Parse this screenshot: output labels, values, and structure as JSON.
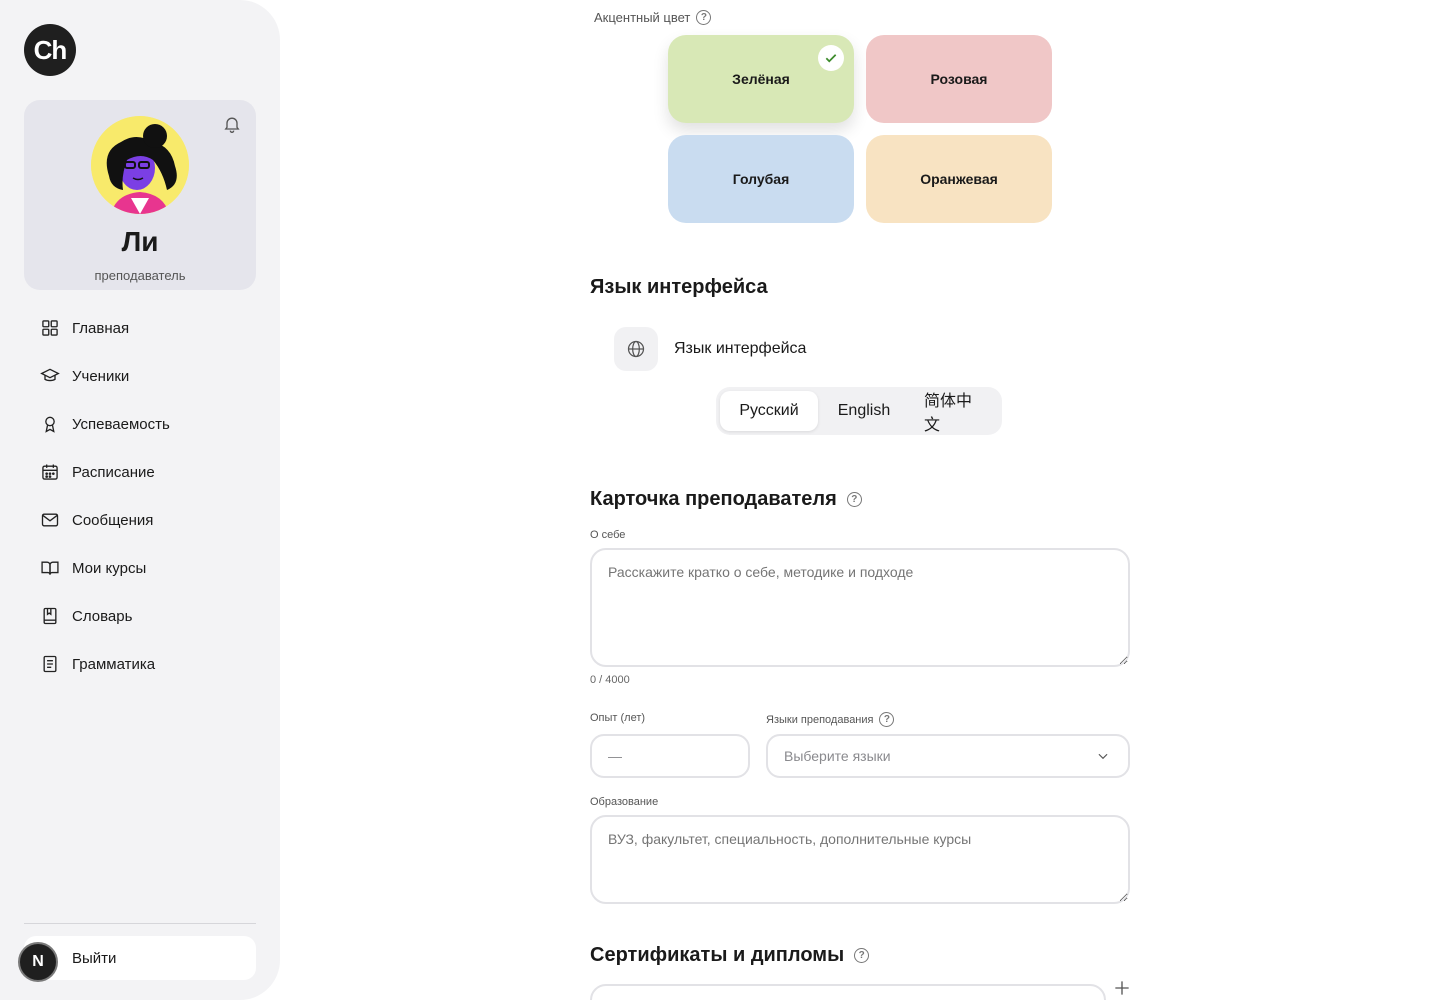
{
  "app": {
    "logo": "Ch"
  },
  "profile": {
    "name": "Ли",
    "role": "преподаватель",
    "bell_icon": "bell-icon"
  },
  "nav": [
    {
      "label": "Главная",
      "icon": "grid-icon"
    },
    {
      "label": "Ученики",
      "icon": "graduation-cap-icon"
    },
    {
      "label": "Успеваемость",
      "icon": "award-icon"
    },
    {
      "label": "Расписание",
      "icon": "calendar-icon"
    },
    {
      "label": "Сообщения",
      "icon": "mail-icon"
    },
    {
      "label": "Мои курсы",
      "icon": "book-open-icon"
    },
    {
      "label": "Словарь",
      "icon": "book-icon"
    },
    {
      "label": "Грамматика",
      "icon": "notebook-icon"
    }
  ],
  "logout": {
    "label": "Выйти",
    "badge": "N"
  },
  "accent": {
    "label": "Акцентный цвет",
    "help": "?",
    "options": [
      {
        "label": "Зелёная",
        "color": "#d8e8b6",
        "selected": true
      },
      {
        "label": "Розовая",
        "color": "#f0c7c7",
        "selected": false
      },
      {
        "label": "Голубая",
        "color": "#c9dcf0",
        "selected": false
      },
      {
        "label": "Оранжевая",
        "color": "#f8e3c2",
        "selected": false
      }
    ]
  },
  "language": {
    "section_title": "Язык интерфейса",
    "row_label": "Язык интерфейса",
    "options": [
      "Русский",
      "English",
      "简体中文"
    ],
    "selected": "Русский"
  },
  "teacher_card": {
    "section_title": "Карточка преподавателя",
    "help": "?",
    "about": {
      "label": "О себе",
      "placeholder": "Расскажите кратко о себе, методике и подходе",
      "counter": "0 / 4000"
    },
    "experience": {
      "label": "Опыт (лет)",
      "placeholder": "—"
    },
    "teaching_languages": {
      "label": "Языки преподавания",
      "help": "?",
      "placeholder": "Выберите языки"
    },
    "education": {
      "label": "Образование",
      "placeholder": "ВУЗ, факультет, специальность, дополнительные курсы"
    }
  },
  "certificates": {
    "section_title": "Сертификаты и дипломы",
    "help": "?"
  }
}
